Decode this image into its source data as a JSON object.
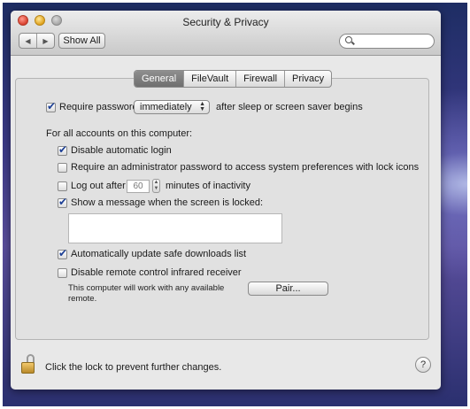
{
  "window": {
    "title": "Security & Privacy"
  },
  "toolbar": {
    "back_icon": "back-arrow-icon",
    "forward_icon": "forward-arrow-icon",
    "show_all_label": "Show All",
    "search_placeholder": ""
  },
  "tabs": [
    {
      "label": "General",
      "active": true
    },
    {
      "label": "FileVault",
      "active": false
    },
    {
      "label": "Firewall",
      "active": false
    },
    {
      "label": "Privacy",
      "active": false
    }
  ],
  "general": {
    "require_password": {
      "checked": true,
      "label": "Require password",
      "delay_value": "immediately",
      "suffix": "after sleep or screen saver begins"
    },
    "all_accounts_heading": "For all accounts on this computer:",
    "disable_auto_login": {
      "checked": true,
      "label": "Disable automatic login"
    },
    "require_admin": {
      "checked": false,
      "label": "Require an administrator password to access system preferences with lock icons"
    },
    "logout": {
      "checked": false,
      "label": "Log out after",
      "minutes": "60",
      "suffix": "minutes of inactivity"
    },
    "show_message": {
      "checked": true,
      "label": "Show a message when the screen is locked:",
      "message": ""
    },
    "auto_update": {
      "checked": true,
      "label": "Automatically update safe downloads list"
    },
    "disable_ir": {
      "checked": false,
      "label": "Disable remote control infrared receiver"
    },
    "ir_note": "This computer will work with any available remote.",
    "pair_label": "Pair..."
  },
  "footer": {
    "lock_text": "Click the lock to prevent further changes.",
    "help_label": "?"
  },
  "colors": {
    "active_tab": "#7a7a7a",
    "check": "#1c3f95"
  }
}
